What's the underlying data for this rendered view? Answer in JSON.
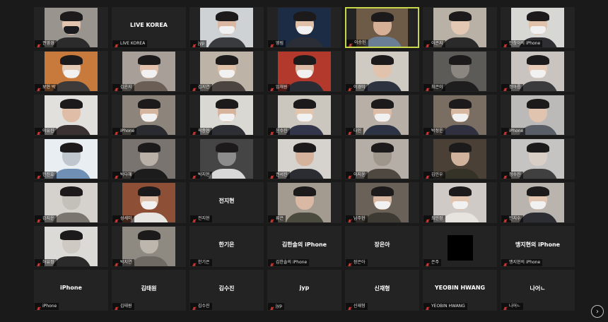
{
  "meeting": {
    "participants": [
      {
        "label": "권영경",
        "tile": "video",
        "bg": "#9a948e",
        "face": "#e2c4ae",
        "mask": "dark",
        "sub": "#2b2b2b"
      },
      {
        "label": "LIVE KOREA",
        "tile": "name",
        "center": "LIVE KOREA"
      },
      {
        "label": "jyp",
        "tile": "video",
        "bg": "#cfd2d4",
        "face": "#d9b7a1",
        "mask": "light",
        "sub": "#3a3b3f"
      },
      {
        "label": "영림",
        "tile": "video",
        "bg": "#1c2c44",
        "face": "#e0c0a8",
        "mask": "light",
        "sub": "#2b2e36"
      },
      {
        "label": "이승헌",
        "tile": "video",
        "bg": "#6d5b47",
        "face": "#d6b096",
        "mask": "none",
        "sub": "#6a7f96",
        "active": true
      },
      {
        "label": "이은지",
        "tile": "video",
        "bg": "#b9b1a6",
        "face": "#e3c8b4",
        "mask": "none",
        "sub": "#2a2a2a"
      },
      {
        "label": "안창이의 iPhone",
        "tile": "video",
        "bg": "#d7d7d4",
        "face": "#e0c2aa",
        "mask": "light",
        "sub": "#2f2f33"
      },
      {
        "label": "보현 박",
        "tile": "video",
        "bg": "#c77a3c",
        "face": "#e4c9b5",
        "mask": "light",
        "sub": "#3e3a3a"
      },
      {
        "label": "김윤지",
        "tile": "video",
        "bg": "#a89f98",
        "face": "#e2c2ac",
        "mask": "light",
        "sub": "#6b5e55"
      },
      {
        "label": "김지연",
        "tile": "video",
        "bg": "#bdb3a6",
        "face": "#dfc0a9",
        "mask": "light",
        "sub": "#4c4440"
      },
      {
        "label": "임채원",
        "tile": "video",
        "bg": "#b2392c",
        "face": "#dcbca6",
        "mask": "light",
        "sub": "#2a2c33"
      },
      {
        "label": "이경미",
        "tile": "video",
        "bg": "#cfcac2",
        "face": "#e1c3ad",
        "mask": "none",
        "sub": "#2e3340"
      },
      {
        "label": "최은이",
        "tile": "video",
        "bg": "#5c5b57",
        "face": "#8b8780",
        "mask": "none",
        "sub": "#1e1e1e"
      },
      {
        "label": "정아름",
        "tile": "video",
        "bg": "#c9c4c0",
        "face": "#e8cbb6",
        "mask": "light",
        "sub": "#3b3b3e"
      },
      {
        "label": "이유진",
        "tile": "video",
        "bg": "#e2e0dd",
        "face": "#dfbda6",
        "mask": "none",
        "sub": "#3a3232"
      },
      {
        "label": "iPhone",
        "tile": "video",
        "bg": "#8d857c",
        "face": "#d6b59f",
        "mask": "light",
        "sub": "#2a2b30"
      },
      {
        "label": "곽종현",
        "tile": "video",
        "bg": "#dad8d2",
        "face": "#d7b39b",
        "mask": "light",
        "sub": "#2d2f34"
      },
      {
        "label": "윤수진",
        "tile": "video",
        "bg": "#ccc7be",
        "face": "#e3c5ae",
        "mask": "light",
        "sub": "#33364a"
      },
      {
        "label": "다인",
        "tile": "video",
        "bg": "#b8b0a7",
        "face": "#ddbda7",
        "mask": "light",
        "sub": "#2c3344"
      },
      {
        "label": "박정운",
        "tile": "video",
        "bg": "#7a6e62",
        "face": "#d8b7a0",
        "mask": "light",
        "sub": "#2f3140"
      },
      {
        "label": "iPhone",
        "tile": "video",
        "bg": "#bcbab8",
        "face": "#e1c4b0",
        "mask": "none",
        "sub": "#595d66"
      },
      {
        "label": "한진호",
        "tile": "video",
        "bg": "#e9eef3",
        "face": "#c0c6ce",
        "mask": "none",
        "sub": "#6f8fb5"
      },
      {
        "label": "박다혜",
        "tile": "video",
        "bg": "#7a7470",
        "face": "#b9b0a8",
        "mask": "none",
        "sub": "#1c1c1c"
      },
      {
        "label": "박지현",
        "tile": "video",
        "bg": "#454545",
        "face": "#8c8c8c",
        "mask": "none",
        "sub": "#d8d8d8"
      },
      {
        "label": "권서진",
        "tile": "video",
        "bg": "#d6d3ce",
        "face": "#d4b29c",
        "mask": "none",
        "sub": "#2b2d33"
      },
      {
        "label": "이지윤",
        "tile": "video",
        "bg": "#b5aea6",
        "face": "#9e958b",
        "mask": "none",
        "sub": "#4f4841"
      },
      {
        "label": "김민우",
        "tile": "video",
        "bg": "#4b4035",
        "face": "#d1b29c",
        "mask": "none",
        "sub": "#353228"
      },
      {
        "label": "정수진",
        "tile": "video",
        "bg": "#c6c4c2",
        "face": "#d9cfc7",
        "mask": "none",
        "sub": "#404040"
      },
      {
        "label": "강지운",
        "tile": "video",
        "bg": "#d5d2ce",
        "face": "#c3bfb9",
        "mask": "none",
        "sub": "#7b756f"
      },
      {
        "label": "성세미",
        "tile": "video",
        "bg": "#8d4f36",
        "face": "#e0c0aa",
        "mask": "light",
        "sub": "#e8e6e3"
      },
      {
        "label": "전지현",
        "tile": "name",
        "center": "전지현"
      },
      {
        "label": "류은",
        "tile": "video",
        "bg": "#a39b90",
        "face": "#d9b9a3",
        "mask": "none",
        "sub": "#4b4a3e"
      },
      {
        "label": "남주현",
        "tile": "video",
        "bg": "#6a6258",
        "face": "#d8b8a2",
        "mask": "light",
        "sub": "#3d3a33"
      },
      {
        "label": "최민정",
        "tile": "video",
        "bg": "#cfcac5",
        "face": "#e2c4ae",
        "mask": "light",
        "sub": "#e7e3df"
      },
      {
        "label": "민지수",
        "tile": "video",
        "bg": "#bab4ae",
        "face": "#e2c6b2",
        "mask": "light",
        "sub": "#2d2e33"
      },
      {
        "label": "하유정",
        "tile": "video",
        "bg": "#dcdad7",
        "face": "#cfc9c3",
        "mask": "none",
        "sub": "#2a2a2a"
      },
      {
        "label": "박지연",
        "tile": "video",
        "bg": "#8e8981",
        "face": "#bdb6ad",
        "mask": "none",
        "sub": "#6f6a63"
      },
      {
        "label": "한기은",
        "tile": "name",
        "center": "한기은"
      },
      {
        "label": "김한솔의 iPhone",
        "tile": "name",
        "center": "김한솔의 iPhone"
      },
      {
        "label": "장은아",
        "tile": "name",
        "center": "장은아"
      },
      {
        "label": "은주",
        "tile": "square"
      },
      {
        "label": "맹지현의 iPhone",
        "tile": "name",
        "center": "맹지현의 iPhone"
      },
      {
        "label": "iPhone",
        "tile": "name",
        "center": "iPhone"
      },
      {
        "label": "김태원",
        "tile": "name",
        "center": "김태원"
      },
      {
        "label": "김수진",
        "tile": "name",
        "center": "김수진"
      },
      {
        "label": "jyp",
        "tile": "name",
        "center": "jyp"
      },
      {
        "label": "신재형",
        "tile": "name",
        "center": "신재형"
      },
      {
        "label": "YEOBIN HWANG",
        "tile": "name",
        "center": "YEOBIN HWANG"
      },
      {
        "label": "나어ㄴ",
        "tile": "name",
        "center": "나어ㄴ"
      }
    ]
  },
  "colors": {
    "background": "#1a1a1a",
    "tile": "#232323",
    "active_speaker_border": "#c8d64a",
    "muted_mic": "#e0413a"
  },
  "icons": {
    "mic": "muted-mic-icon",
    "next": "chevron-right-icon"
  },
  "controls": {
    "next_page_glyph": "›"
  }
}
